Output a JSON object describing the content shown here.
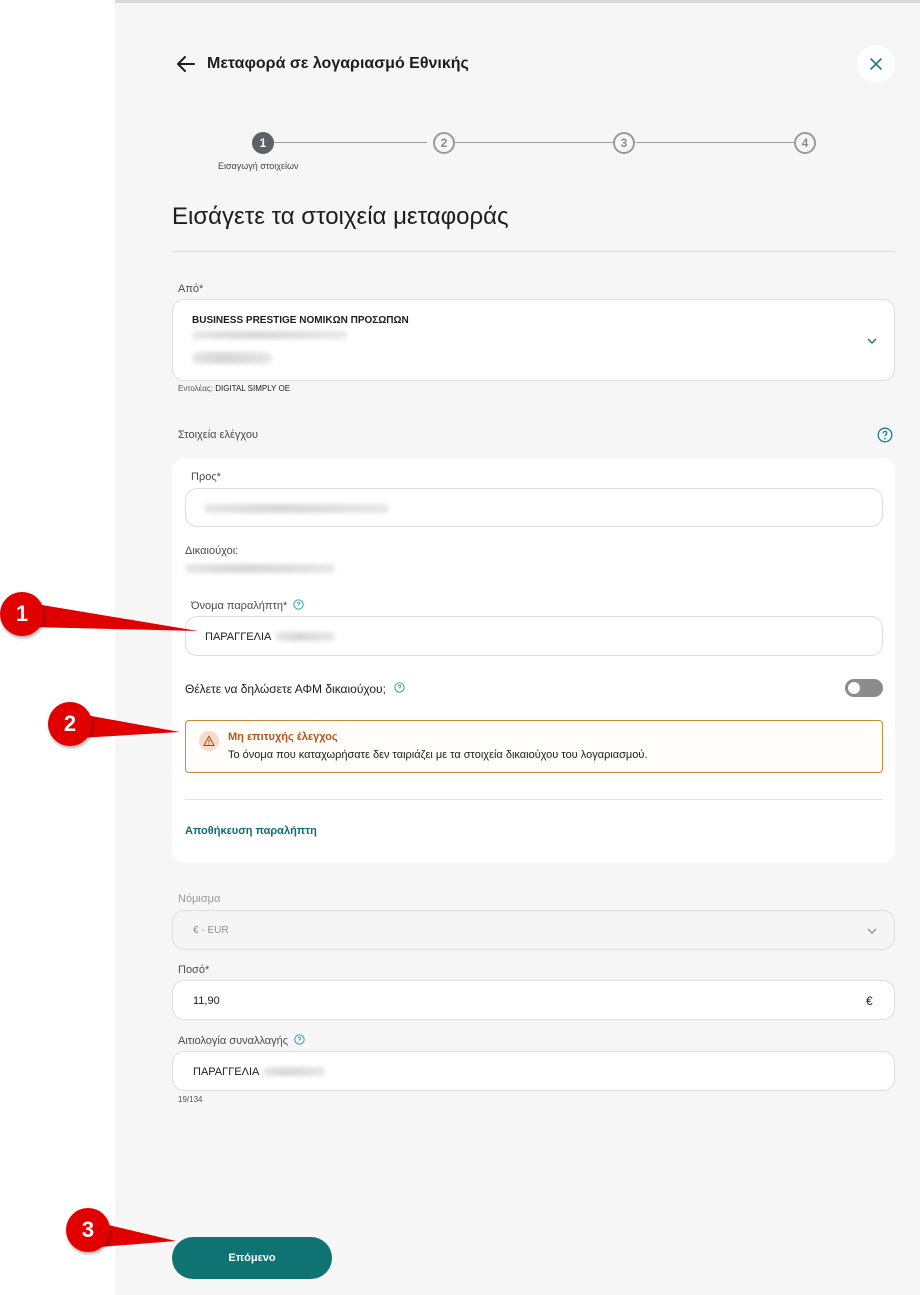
{
  "header": {
    "title": "Μεταφορά σε λογαριασμό Εθνικής"
  },
  "stepper": {
    "steps": [
      "1",
      "2",
      "3",
      "4"
    ],
    "current_label": "Εισαγωγή στοιχείων"
  },
  "page": {
    "heading": "Εισάγετε τα στοιχεία μεταφοράς"
  },
  "from": {
    "label": "Από*",
    "account_name": "BUSINESS PRESTIGE ΝΟΜΙΚΩΝ ΠΡΟΣΩΠΩΝ",
    "orderer_label": "Εντολέας:",
    "orderer_value": "DIGITAL SIMPLY OE"
  },
  "control": {
    "section_label": "Στοιχεία ελέγχου",
    "to_label": "Προς*",
    "beneficiaries_label": "Δικαιούχοι:",
    "recipient_name_label": "Όνομα παραλήπτη*",
    "recipient_name_value": "ΠΑΡΑΓΓΕΛΙΑ",
    "vat_question": "Θέλετε να δηλώσετε ΑΦΜ δικαιούχου;",
    "warning_title": "Μη επιτυχής έλεγχος",
    "warning_text": "Το όνομα που καταχωρήσατε δεν ταιριάζει με τα στοιχεία δικαιούχου του λογαριασμού.",
    "save_recipient": "Αποθήκευση παραλήπτη"
  },
  "currency": {
    "label": "Νόμισμα",
    "value": "€ - EUR"
  },
  "amount": {
    "label": "Ποσό*",
    "value": "11,90",
    "symbol": "€"
  },
  "reason": {
    "label": "Αιτιολογία συναλλαγής",
    "value": "ΠΑΡΑΓΓΕΛΙΑ",
    "counter": "19/134"
  },
  "actions": {
    "next": "Επόμενο"
  },
  "callouts": [
    "1",
    "2",
    "3"
  ],
  "colors": {
    "accent": "#0f7373",
    "warning": "#b4551a",
    "callout": "#e10000"
  }
}
